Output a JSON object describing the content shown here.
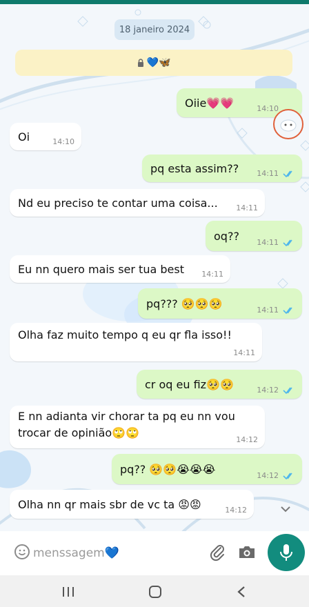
{
  "chat": {
    "date": "18 janeiro 2024",
    "pinned_notice": "💙🦋",
    "messages": [
      {
        "dir": "out",
        "text": "Oiie💗💗",
        "time": "14:10"
      },
      {
        "dir": "in",
        "text": "Oi",
        "time": "14:10"
      },
      {
        "dir": "out",
        "text": "pq esta assim??",
        "time": "14:11"
      },
      {
        "dir": "in",
        "text": "Nd eu preciso te contar uma coisa...",
        "time": "14:11"
      },
      {
        "dir": "out",
        "text": "oq??",
        "time": "14:11"
      },
      {
        "dir": "in",
        "text": "Eu nn quero mais ser tua best",
        "time": "14:11"
      },
      {
        "dir": "out",
        "text": "pq??? 🥺🥺🥺",
        "time": "14:11"
      },
      {
        "dir": "in",
        "text": "Olha faz muito tempo q eu qr fla isso!!",
        "time": "14:11"
      },
      {
        "dir": "out",
        "text": "cr oq eu fiz🥺🥺",
        "time": "14:12"
      },
      {
        "dir": "in",
        "text": "E nn adianta vir chorar ta pq eu nn vou trocar de opinião🙄🙄",
        "time": "14:12"
      },
      {
        "dir": "out",
        "text": "pq?? 🥺🥺😭😭😭",
        "time": "14:12"
      },
      {
        "dir": "in",
        "text": "Olha nn qr mais sbr de vc ta 😡😡",
        "time": "14:12"
      }
    ]
  },
  "input": {
    "placeholder": "menssagem💙"
  },
  "icons": {
    "lock": "lock-icon",
    "emoji": "emoji-icon",
    "attach": "paperclip-icon",
    "camera": "camera-icon",
    "mic": "mic-icon",
    "scroll": "chevron-down-icon",
    "recent": "recent-apps-icon",
    "home": "home-icon",
    "back": "back-icon"
  },
  "colors": {
    "outgoing": "#dcf8c6",
    "incoming": "#ffffff",
    "accent": "#128c7e",
    "ticks": "#4fb6ec"
  }
}
